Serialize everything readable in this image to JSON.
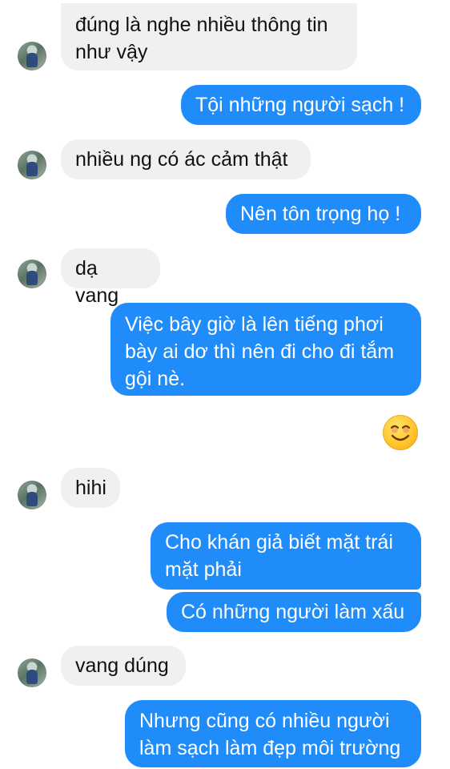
{
  "conversation": {
    "messages": [
      {
        "sender": "contact",
        "text": "đúng là nghe nhiều thông tin\nnhư vậy"
      },
      {
        "sender": "me",
        "text": "Tội những người sạch !"
      },
      {
        "sender": "contact",
        "text": "nhiều ng có ác cảm thật"
      },
      {
        "sender": "me",
        "text": "Nên tôn trọng họ !"
      },
      {
        "sender": "contact",
        "text": "dạ vang"
      },
      {
        "sender": "me",
        "text": "Việc bây giờ là lên tiếng phơi\nbày ai dơ thì nên đi cho đi tắm\ngội nè."
      },
      {
        "sender": "me",
        "icon": "smiling-face-emoji"
      },
      {
        "sender": "contact",
        "text": "hihi"
      },
      {
        "sender": "me",
        "text": "Cho khán giả biết mặt trái\nmặt phải"
      },
      {
        "sender": "me",
        "text": "Có những người làm xấu"
      },
      {
        "sender": "contact",
        "text": "vang dúng"
      },
      {
        "sender": "me",
        "text": "Nhưng cũng có nhiều người\nlàm sạch làm đẹp môi trường"
      }
    ]
  },
  "colors": {
    "incoming_bubble": "#f0f0f0",
    "outgoing_bubble": "#1f8cf9",
    "outgoing_text": "#ffffff",
    "incoming_text": "#111111"
  }
}
